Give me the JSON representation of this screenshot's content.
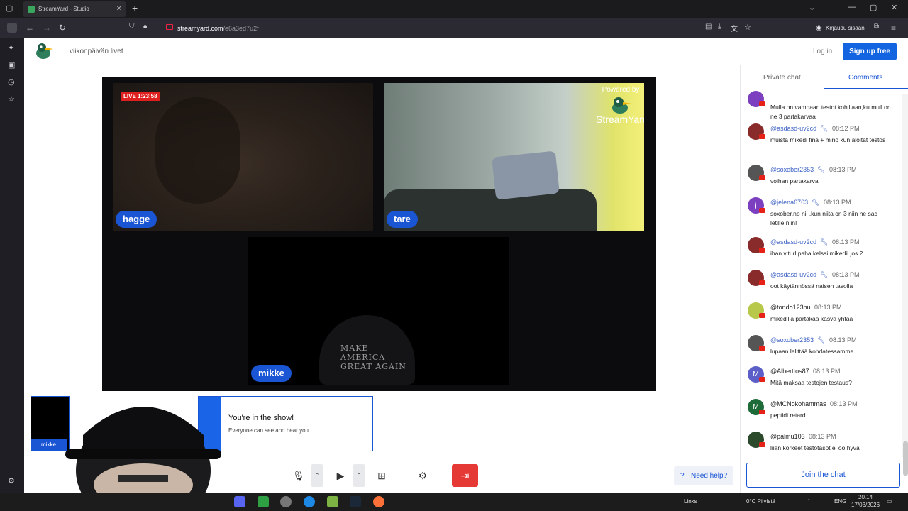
{
  "browser": {
    "tab_title": "StreamYard - Studio",
    "url_domain": "streamyard.com",
    "url_path": "/e6a3ed7u2f",
    "signin_label": "Kirjaudu sisään"
  },
  "header": {
    "broadcast_title": "viikonpäivän livet",
    "login_label": "Log in",
    "signup_label": "Sign up free"
  },
  "stage": {
    "live_badge": "LIVE 1:23:58",
    "powered_by": "Powered by",
    "brand": "StreamYard",
    "participants": [
      "hagge",
      "tare",
      "mikke"
    ],
    "cap_text": "MAKE AMERICA\nGREAT AGAIN"
  },
  "self_view": {
    "label": "mikke"
  },
  "toast": {
    "title": "You're in the show!",
    "subtitle": "Everyone can see and hear you"
  },
  "controls": {
    "help_label": "Need help?"
  },
  "chat": {
    "tabs": [
      "Private chat",
      "Comments"
    ],
    "active_tab": "Comments",
    "join_label": "Join the chat",
    "messages": [
      {
        "author": "",
        "time": "",
        "text": "Mulla on vamnaan testot kohillaan,ku mull on ne 3 partakarvaa",
        "avatar": "",
        "color": "#7b3fbf",
        "mod": false
      },
      {
        "author": "@asdasd-uv2cd",
        "time": "08:12 PM",
        "text": "muista mikedi fina + mino kun aloitat testos",
        "avatar": "",
        "color": "#8a2b2b",
        "mod": true
      },
      {
        "author": "@soxober2353",
        "time": "08:13 PM",
        "text": "voihan partakarva",
        "avatar": "",
        "color": "#555555",
        "mod": true
      },
      {
        "author": "@jelena6763",
        "time": "08:13 PM",
        "text": "soxober,no nii ,kun niita on 3 niin ne sac letille,niin!",
        "avatar": "j",
        "color": "#7b3fbf",
        "mod": true
      },
      {
        "author": "@asdasd-uv2cd",
        "time": "08:13 PM",
        "text": "ihan viturl paha kelssi mikedil jos 2",
        "avatar": "",
        "color": "#8a2b2b",
        "mod": true
      },
      {
        "author": "@asdasd-uv2cd",
        "time": "08:13 PM",
        "text": "oot käytännössä naisen tasolla",
        "avatar": "",
        "color": "#8a2b2b",
        "mod": true
      },
      {
        "author": "@tondo123hu",
        "time": "08:13 PM",
        "text": "mikedillä partakaa kasva yhtää",
        "avatar": "",
        "color": "#b8c84a",
        "mod": false
      },
      {
        "author": "@soxober2353",
        "time": "08:13 PM",
        "text": "lupaan lelittää kohdatessamme",
        "avatar": "",
        "color": "#555555",
        "mod": true
      },
      {
        "author": "@Alberttos87",
        "time": "08:13 PM",
        "text": "Mitä maksaa testojen testaus?",
        "avatar": "M",
        "color": "#5b5fc7",
        "mod": false
      },
      {
        "author": "@MCNokohammas",
        "time": "08:13 PM",
        "text": "peptidi retard",
        "avatar": "M",
        "color": "#1e6b3a",
        "mod": false
      },
      {
        "author": "@palmu103",
        "time": "08:13 PM",
        "text": "liian korkeet testotasot ei oo hyvä",
        "avatar": "",
        "color": "#2b4a2b",
        "mod": false
      }
    ]
  },
  "taskbar": {
    "links_label": "Links",
    "weather": "0°C Pilvistä",
    "language": "ENG",
    "clock_time": "20.14",
    "clock_date": "17/03/2026"
  },
  "colors": {
    "accent": "#1a55d4",
    "live": "#e0201f",
    "leave": "#e53935"
  }
}
